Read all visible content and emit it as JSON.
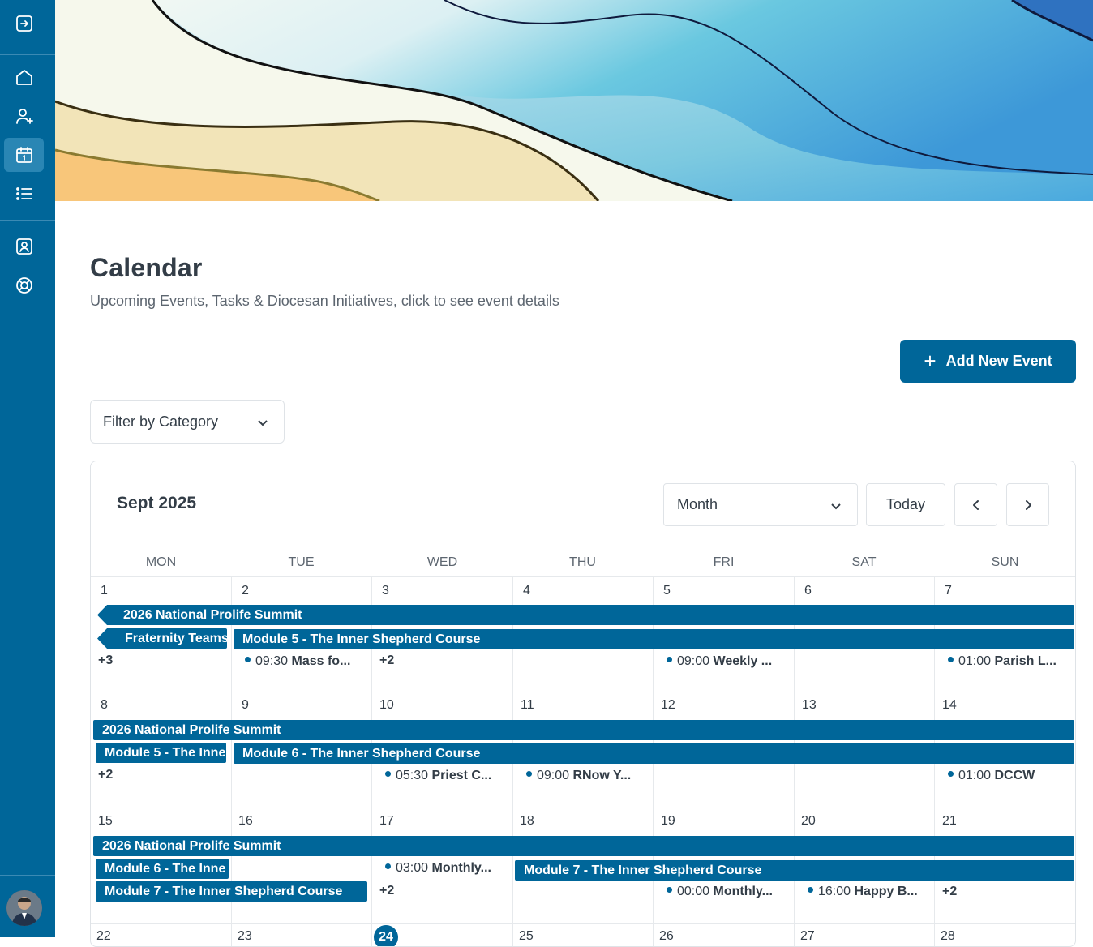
{
  "sidebar": {
    "icons": [
      "logout-icon",
      "home-icon",
      "user-plus-icon",
      "calendar-icon",
      "list-icon",
      "contact-icon",
      "help-icon"
    ],
    "accent": "#006699"
  },
  "header": {
    "title": "Calendar",
    "subtitle": "Upcoming Events, Tasks & Diocesan Initiatives, click to see event details",
    "add_button": "Add New Event"
  },
  "filter": {
    "label": "Filter by Category"
  },
  "calendar": {
    "month_label": "Sept 2025",
    "view": "Month",
    "today_label": "Today",
    "weekdays": [
      "MON",
      "TUE",
      "WED",
      "THU",
      "FRI",
      "SAT",
      "SUN"
    ],
    "weeks": [
      {
        "days": [
          "1",
          "2",
          "3",
          "4",
          "5",
          "6",
          "7"
        ],
        "bars": [
          "2026 National Prolife Summit",
          "Fraternity Teams",
          "Module 5 - The Inner Shepherd Course"
        ],
        "events": [
          {
            "time": "09:30",
            "name": "Mass fo..."
          },
          {
            "time": "09:00",
            "name": "Weekly ..."
          },
          {
            "time": "01:00",
            "name": "Parish L..."
          }
        ],
        "more": [
          "+3",
          "+2"
        ]
      },
      {
        "days": [
          "8",
          "9",
          "10",
          "11",
          "12",
          "13",
          "14"
        ],
        "bars": [
          "2026 National Prolife Summit",
          "Module 5 - The Inne",
          "Module 6 - The Inner Shepherd Course"
        ],
        "events": [
          {
            "time": "05:30",
            "name": "Priest C..."
          },
          {
            "time": "09:00",
            "name": "RNow Y..."
          },
          {
            "time": "01:00",
            "name": "DCCW"
          }
        ],
        "more": [
          "+2"
        ]
      },
      {
        "days": [
          "15",
          "16",
          "17",
          "18",
          "19",
          "20",
          "21"
        ],
        "bars": [
          "2026 National Prolife Summit",
          "Module 6 - The Inne",
          "Module 7 - The Inner Shepherd Course",
          "Module 7 - The Inner Shepherd Course"
        ],
        "events": [
          {
            "time": "03:00",
            "name": "Monthly..."
          },
          {
            "time": "00:00",
            "name": "Monthly..."
          },
          {
            "time": "16:00",
            "name": "Happy B..."
          }
        ],
        "more": [
          "+2",
          "+2"
        ]
      },
      {
        "days": [
          "22",
          "23",
          "24",
          "25",
          "26",
          "27",
          "28"
        ]
      }
    ]
  }
}
